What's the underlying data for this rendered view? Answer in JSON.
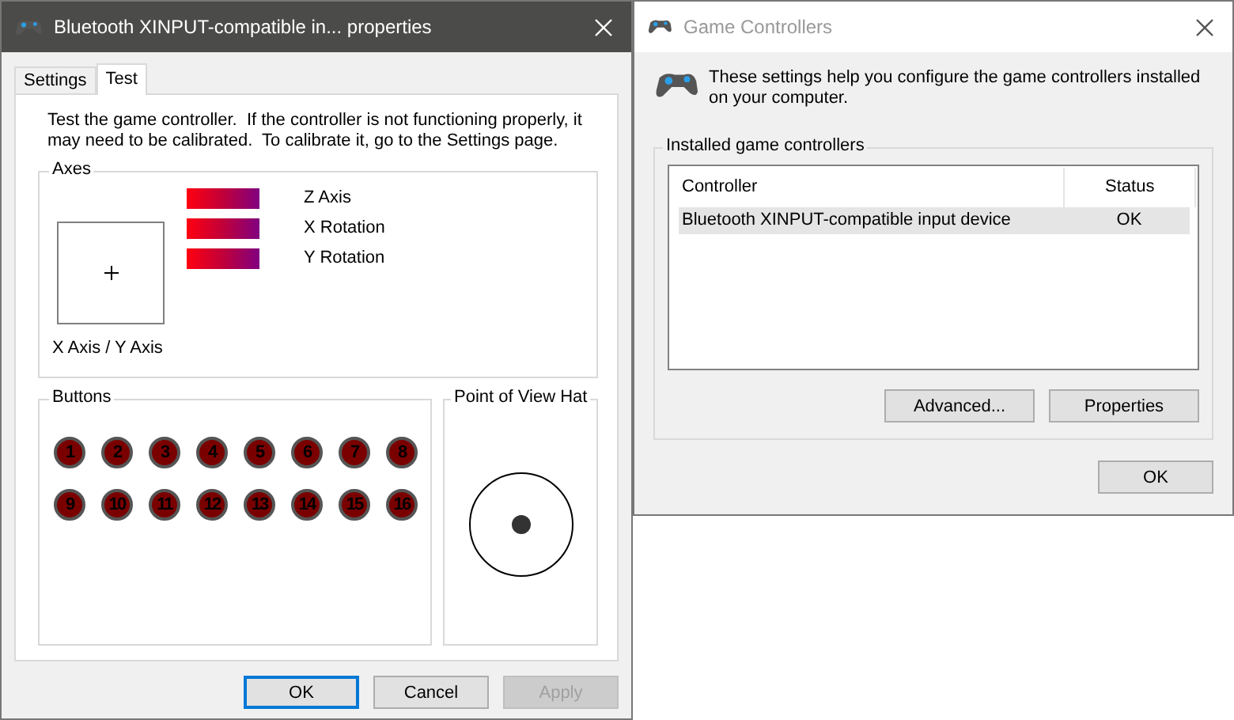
{
  "properties_window": {
    "title": "Bluetooth XINPUT-compatible in... properties",
    "active": true,
    "tabs": [
      {
        "label": "Settings",
        "selected": false
      },
      {
        "label": "Test",
        "selected": true
      }
    ],
    "description": "Test the game controller.  If the controller is not functioning properly, it may need to be calibrated.  To calibrate it, go to the Settings page.",
    "axes": {
      "title": "Axes",
      "xy_label": "X Axis / Y Axis",
      "bars": [
        {
          "label": "Z Axis"
        },
        {
          "label": "X Rotation"
        },
        {
          "label": "Y Rotation"
        }
      ]
    },
    "buttons_group": {
      "title": "Buttons",
      "buttons": [
        {
          "label": "1",
          "pressed": false
        },
        {
          "label": "2",
          "pressed": false
        },
        {
          "label": "3",
          "pressed": false
        },
        {
          "label": "4",
          "pressed": false
        },
        {
          "label": "5",
          "pressed": false
        },
        {
          "label": "6",
          "pressed": false
        },
        {
          "label": "7",
          "pressed": false
        },
        {
          "label": "8",
          "pressed": false
        },
        {
          "label": "9",
          "pressed": false
        },
        {
          "label": "10",
          "pressed": false
        },
        {
          "label": "11",
          "pressed": false
        },
        {
          "label": "12",
          "pressed": false
        },
        {
          "label": "13",
          "pressed": false
        },
        {
          "label": "14",
          "pressed": false
        },
        {
          "label": "15",
          "pressed": false
        },
        {
          "label": "16",
          "pressed": false
        }
      ]
    },
    "pov": {
      "title": "Point of View Hat"
    },
    "dialog_buttons": [
      {
        "label": "OK",
        "focused": true,
        "disabled": false
      },
      {
        "label": "Cancel",
        "focused": false,
        "disabled": false
      },
      {
        "label": "Apply",
        "focused": false,
        "disabled": true
      }
    ]
  },
  "controllers_window": {
    "title": "Game Controllers",
    "active": false,
    "intro": "These settings help you configure the game controllers installed on your computer.",
    "group_title": "Installed game controllers",
    "table": {
      "columns": [
        "Controller",
        "Status"
      ],
      "rows": [
        {
          "cells": [
            "Bluetooth XINPUT-compatible input device",
            "OK"
          ],
          "selected": true
        }
      ]
    },
    "buttons": [
      "Advanced...",
      "Properties"
    ],
    "ok_button": "OK"
  }
}
